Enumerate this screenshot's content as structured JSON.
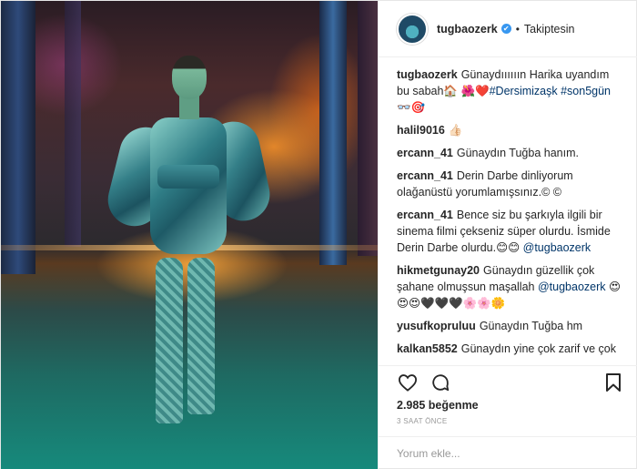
{
  "header": {
    "username": "tugbaozerk",
    "verified_glyph": "✔",
    "separator": "•",
    "follow_status": "Takiptesin"
  },
  "comments": [
    {
      "user": "tugbaozerk",
      "text": "Günaydıııııın Harika uyandım bu sabah🏠 🌺❤️",
      "tags": "#Dersimizaşk #son5gün",
      "suffix": " 👓🎯"
    },
    {
      "user": "halil9016",
      "text": "👍🏻",
      "tags": "",
      "suffix": ""
    },
    {
      "user": "ercann_41",
      "text": "Günaydın Tuğba hanım.",
      "tags": "",
      "suffix": ""
    },
    {
      "user": "ercann_41",
      "text": "Derin Darbe dinliyorum olağanüstü yorumlamışsınız.© ©",
      "tags": "",
      "suffix": ""
    },
    {
      "user": "ercann_41",
      "text": "Bence siz bu şarkıyla ilgili bir sinema filmi çekseniz süper olurdu. İsmide Derin Darbe olurdu.😊😊",
      "tags": "@tugbaozerk",
      "suffix": ""
    },
    {
      "user": "hikmetgunay20",
      "text": "Günaydın güzellik çok şahane olmuşsun maşallah",
      "tags": "@tugbaozerk",
      "suffix": " 😍😍😍🖤🖤🖤🌸🌸🌼"
    },
    {
      "user": "yusufkopruluu",
      "text": "Günaydın Tuğba hm",
      "tags": "",
      "suffix": ""
    },
    {
      "user": "kalkan5852",
      "text": "Günaydın yine çok zarif ve çok güzelsiniz sevgiler",
      "tags": "",
      "suffix": ""
    }
  ],
  "actions": {
    "like_icon": "heart-icon",
    "comment_icon": "comment-icon",
    "save_icon": "bookmark-icon"
  },
  "likes": "2.985 beğenme",
  "timestamp": "3 SAAT ÖNCE",
  "add_comment": {
    "placeholder": "Yorum ekle..."
  }
}
